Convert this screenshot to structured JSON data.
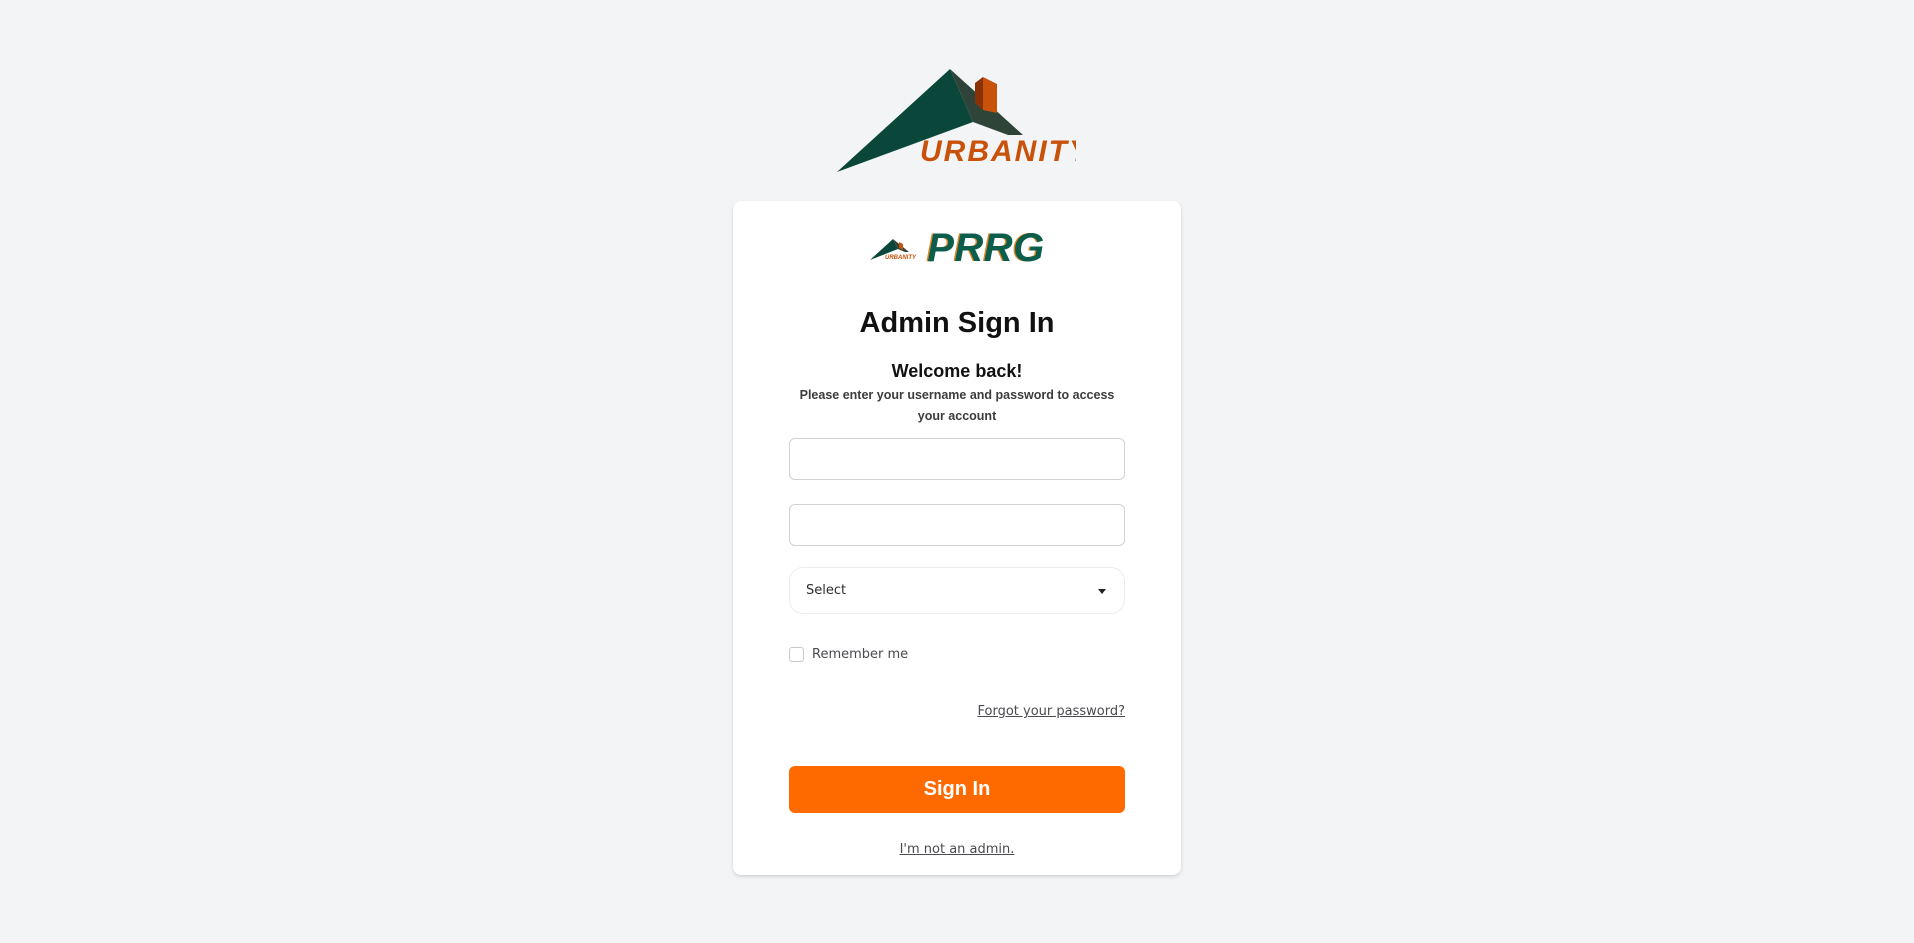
{
  "logo": {
    "brand_text": "URBANITY",
    "colors": {
      "roof_dark": "#0a473a",
      "roof_shade": "#2e4438",
      "chimney": "#c9520a",
      "chimney_dark": "#8a3206",
      "text": "#c9520a"
    }
  },
  "card": {
    "brand_name": "PRRG",
    "mini_logo_text": "URBANITY",
    "title": "Admin Sign In",
    "welcome": "Welcome back!",
    "description": "Please enter your username and password to access your account",
    "username": {
      "value": "",
      "placeholder": ""
    },
    "password": {
      "value": "",
      "placeholder": ""
    },
    "role_select": {
      "value": "Select"
    },
    "remember_me": {
      "label": "Remember me",
      "checked": false
    },
    "forgot_password": "Forgot your password?",
    "sign_in_button": "Sign In",
    "not_admin_link": "I'm not an admin.",
    "accent_color": "#ff6a00",
    "brand_color": "#0b5e4c"
  }
}
